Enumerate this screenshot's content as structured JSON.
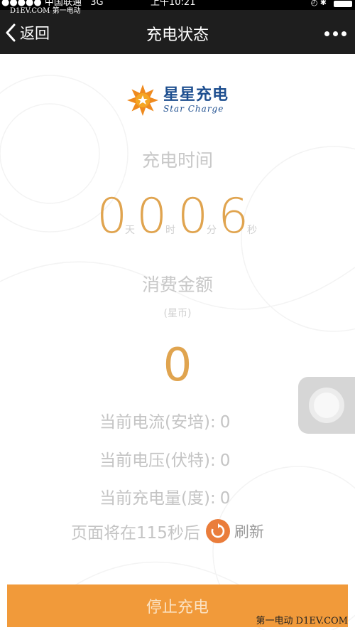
{
  "status_bar": {
    "carrier": "●●●●● 中国联通",
    "network": "3G",
    "time": "上午10:21",
    "icons": "◴ ✱"
  },
  "watermarks": {
    "top": "D1EV.COM 第一电动",
    "bottom": "第一电动 D1EV.COM"
  },
  "nav": {
    "back_label": "返回",
    "title": "充电状态"
  },
  "logo": {
    "name_cn": "星星充电",
    "name_en": "Star Charge"
  },
  "charging_time": {
    "label": "充电时间",
    "digits": [
      "0",
      "0",
      "0",
      "6"
    ],
    "units": [
      "天",
      "时",
      "分",
      "秒"
    ]
  },
  "cost": {
    "label": "消费金额",
    "unit": "(星币)",
    "value": "0"
  },
  "metrics": [
    {
      "label": "当前电流(安培):",
      "value": "0"
    },
    {
      "label": "当前电压(伏特):",
      "value": "0"
    },
    {
      "label": "当前充电量(度):",
      "value": "0"
    }
  ],
  "refresh": {
    "text": "页面将在115秒后",
    "label": "刷新"
  },
  "stop_button": "停止充电",
  "colors": {
    "accent": "#e0a44f",
    "button": "#f19a3a",
    "refresh": "#ea7d3b",
    "navbar": "#1e1e1e"
  }
}
